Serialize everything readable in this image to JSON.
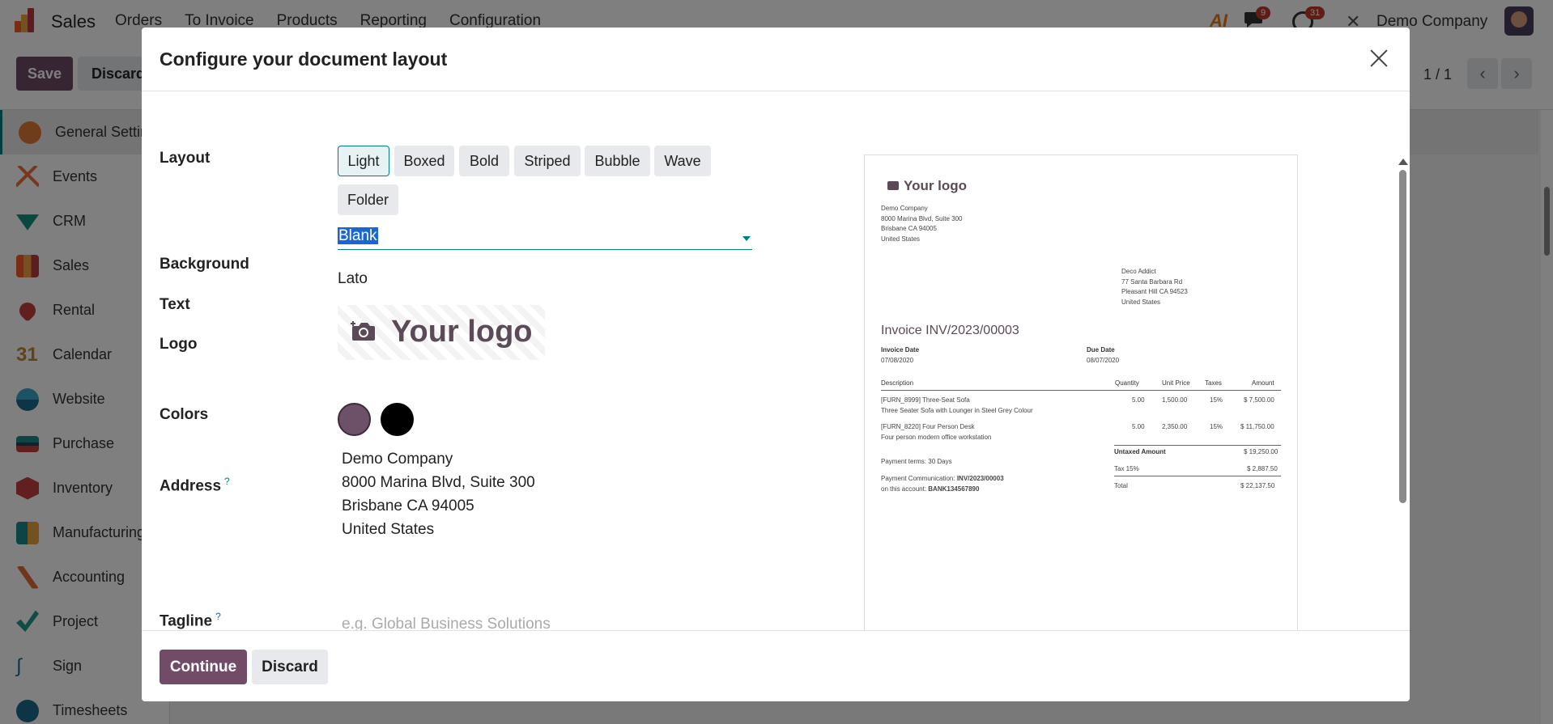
{
  "app": {
    "name": "Sales",
    "menu": [
      "Orders",
      "To Invoice",
      "Products",
      "Reporting",
      "Configuration"
    ],
    "company": "Demo Company",
    "chat_badge": "9",
    "activity_badge": "31",
    "ai_label": "AI"
  },
  "control_panel": {
    "save_label": "Save",
    "discard_label": "Discard",
    "pager": "1 / 1"
  },
  "sidebar": {
    "items": [
      {
        "label": "General Settings",
        "icon": "settings-icon"
      },
      {
        "label": "Events",
        "icon": "events-icon"
      },
      {
        "label": "CRM",
        "icon": "crm-icon"
      },
      {
        "label": "Sales",
        "icon": "sales-icon"
      },
      {
        "label": "Rental",
        "icon": "rental-icon"
      },
      {
        "label": "Calendar",
        "icon": "calendar-icon"
      },
      {
        "label": "Website",
        "icon": "website-icon"
      },
      {
        "label": "Purchase",
        "icon": "purchase-icon"
      },
      {
        "label": "Inventory",
        "icon": "inventory-icon"
      },
      {
        "label": "Manufacturing",
        "icon": "manufacturing-icon"
      },
      {
        "label": "Accounting",
        "icon": "accounting-icon"
      },
      {
        "label": "Project",
        "icon": "project-icon"
      },
      {
        "label": "Sign",
        "icon": "sign-icon"
      },
      {
        "label": "Timesheets",
        "icon": "timesheets-icon"
      }
    ]
  },
  "modal": {
    "title": "Configure your document layout",
    "labels": {
      "layout": "Layout",
      "background": "Background",
      "text": "Text",
      "logo": "Logo",
      "colors": "Colors",
      "address": "Address",
      "tagline": "Tagline",
      "help": "?"
    },
    "layouts": [
      "Light",
      "Boxed",
      "Bold",
      "Striped",
      "Bubble",
      "Wave",
      "Folder"
    ],
    "selected_layout": "Light",
    "background_value": "Blank",
    "text_value": "Lato",
    "logo_text": "Your logo",
    "colors": {
      "primary": "#6c5168",
      "secondary": "#000000"
    },
    "address_lines": [
      "Demo Company",
      "8000 Marina Blvd, Suite 300",
      "Brisbane CA 94005",
      "United States"
    ],
    "tagline_placeholder": "e.g. Global Business Solutions",
    "continue_label": "Continue",
    "discard_label": "Discard"
  },
  "preview": {
    "logo_text": "Your logo",
    "company_lines": [
      "Demo Company",
      "8000 Marina Blvd, Suite 300",
      "Brisbane CA 94005",
      "United States"
    ],
    "customer_lines": [
      "Deco Addict",
      "77 Santa Barbara Rd",
      "Pleasant Hill CA 94523",
      "United States"
    ],
    "invoice_title": "Invoice INV/2023/00003",
    "invoice_date_label": "Invoice Date",
    "invoice_date": "07/08/2020",
    "due_date_label": "Due Date",
    "due_date": "08/07/2020",
    "columns": [
      "Description",
      "Quantity",
      "Unit Price",
      "Taxes",
      "Amount"
    ],
    "lines": [
      {
        "desc": "[FURN_8999] Three-Seat Sofa",
        "sub": "Three Seater Sofa with Lounger in Steel Grey Colour",
        "qty": "5.00",
        "price": "1,500.00",
        "tax": "15%",
        "amount": "$ 7,500.00"
      },
      {
        "desc": "[FURN_8220] Four Person Desk",
        "sub": "Four person modern office workstation",
        "qty": "5.00",
        "price": "2,350.00",
        "tax": "15%",
        "amount": "$ 11,750.00"
      }
    ],
    "payment_terms": "Payment terms: 30 Days",
    "payment_comm_label": "Payment Communication:",
    "payment_comm_ref": "INV/2023/00003",
    "account_label": "on this account:",
    "account_number": "BANK134567890",
    "untaxed_label": "Untaxed Amount",
    "untaxed_value": "$ 19,250.00",
    "tax_label": "Tax 15%",
    "tax_value": "$ 2,887.50",
    "total_label": "Total",
    "total_value": "$ 22,137.50"
  }
}
